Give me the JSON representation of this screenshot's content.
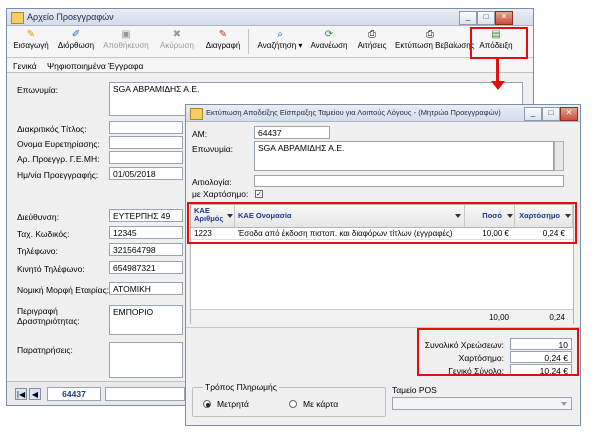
{
  "main_window": {
    "title": "Αρχείο Προεγγραφών",
    "toolbar": [
      {
        "label": "Εισαγωγή",
        "icon": "new-doc-icon",
        "enabled": true
      },
      {
        "label": "Διόρθωση",
        "icon": "edit-icon",
        "enabled": true
      },
      {
        "label": "Αποθήκευση",
        "icon": "save-icon",
        "enabled": false
      },
      {
        "label": "Ακύρωση",
        "icon": "cancel-icon",
        "enabled": false
      },
      {
        "label": "Διαγραφή",
        "icon": "delete-icon",
        "enabled": true
      },
      {
        "label": "Αναζήτηση",
        "icon": "search-icon",
        "enabled": true
      },
      {
        "label": "Ανανέωση",
        "icon": "refresh-icon",
        "enabled": true
      },
      {
        "label": "Αιτήσεις",
        "icon": "print-icon",
        "enabled": true
      },
      {
        "label": "Εκτύπωση Βεβαίωσης",
        "icon": "print-icon",
        "enabled": true
      },
      {
        "label": "Απόδειξη",
        "icon": "receipt-icon",
        "enabled": true
      }
    ],
    "tabs": [
      "Γενικά",
      "Ψηφιοποιημένα Έγγραφα"
    ],
    "fields": {
      "eponymia_label": "Επωνυμία:",
      "eponymia_value": "SGA ΑΒΡΑΜΙΔΗΣ Α.Ε.",
      "diakritikos_label": "Διακριτικός Τίτλος:",
      "onoma_label": "Ονομα Ευρετηρίασης:",
      "gemh_label": "Αρ. Προεγγρ. Γ.Ε.ΜΗ:",
      "date_label": "Ημ/νία Προεγγραφής:",
      "date_value": "01/05/2018",
      "address_label": "Διεύθυνση:",
      "address_value": "ΕΥΤΕΡΠΗΣ 49",
      "tk_label": "Ταχ. Κωδικός:",
      "tk_value": "12345",
      "phone_label": "Τηλέφωνο:",
      "phone_value": "321564798",
      "mobile_label": "Κινητό Τηλέφωνο:",
      "mobile_value": "654987321",
      "legal_label": "Νομική Μορφή Εταιρίας:",
      "legal_value": "ΑΤΟΜΙΚΗ",
      "activity_label": "Περιγραφή Δραστηριότητας:",
      "activity_value": "ΕΜΠΟΡΙΟ",
      "notes_label": "Παρατηρήσεις:"
    },
    "record_nav_value": "64437"
  },
  "dialog": {
    "title": "Εκτύπωση Αποδείξης Είσπραξης Ταμείου για Λοιπούς Λόγους - (Μητρώο Προεγγραφών)",
    "am_label": "ΑΜ:",
    "am_value": "64437",
    "eponymia_label": "Επωνυμία:",
    "eponymia_value": "SGA ΑΒΡΑΜΙΔΗΣ Α.Ε.",
    "aitiologia_label": "Αιτιολογία:",
    "xartosimo_label": "με Χαρτόσημο:",
    "xartosimo_checked": true,
    "grid": {
      "columns": [
        "ΚΑΕ Αριθμός",
        "ΚΑΕ Ονομασία",
        "Ποσό",
        "Χαρτόσημο"
      ],
      "rows": [
        {
          "kae": "1223",
          "name": "Έσοδα από έκδοση πιστοπ. και διαφόρων τίτλων (εγγραφές)",
          "amount": "10,00 €",
          "stamp": "0,24 €"
        }
      ],
      "footer_amount": "10,00",
      "footer_stamp": "0,24"
    },
    "totals": {
      "count_label": "Συνολικό Χρεώσεων:",
      "count_value": "10",
      "stamp_label": "Χαρτόσημο:",
      "stamp_value": "0,24 €",
      "total_label": "Γενικό Σύνολο:",
      "total_value": "10,24 €"
    },
    "payment": {
      "group_label": "Τρόπος Πληρωμής",
      "cash_label": "Μετρητά",
      "card_label": "Με κάρτα",
      "selected": "Μετρητά",
      "pos_label": "Ταμείο POS"
    }
  },
  "colors": {
    "highlight": "#e01010",
    "header_text": "#1b3a8a"
  }
}
